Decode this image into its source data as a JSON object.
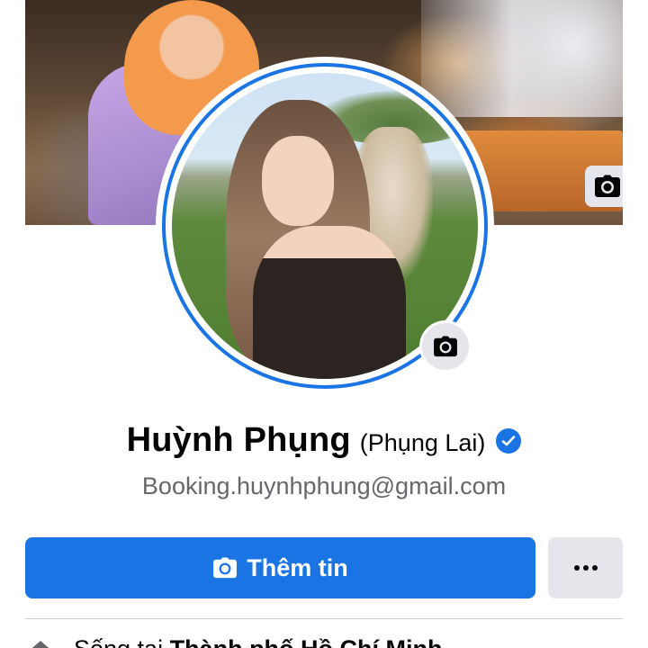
{
  "profile": {
    "name": "Huỳnh Phụng",
    "alternate_name": "(Phụng Lai)",
    "verified": true,
    "contact_email": "Booking.huynhphung@gmail.com"
  },
  "actions": {
    "add_story_label": "Thêm tin",
    "more_label": "•••"
  },
  "intro": {
    "lives_in_prefix": "Sống tại",
    "lives_in_city": "Thành phố Hồ Chí Minh"
  },
  "icons": {
    "cover_camera": "camera-icon",
    "avatar_camera": "camera-icon",
    "verified": "verified-badge-icon",
    "add_story": "camera-icon",
    "more": "more-dots-icon",
    "lives_in": "home-icon"
  },
  "colors": {
    "accent": "#1b74e4",
    "secondary_button": "#e4e6eb",
    "muted_text": "#65676b",
    "text": "#050505"
  }
}
